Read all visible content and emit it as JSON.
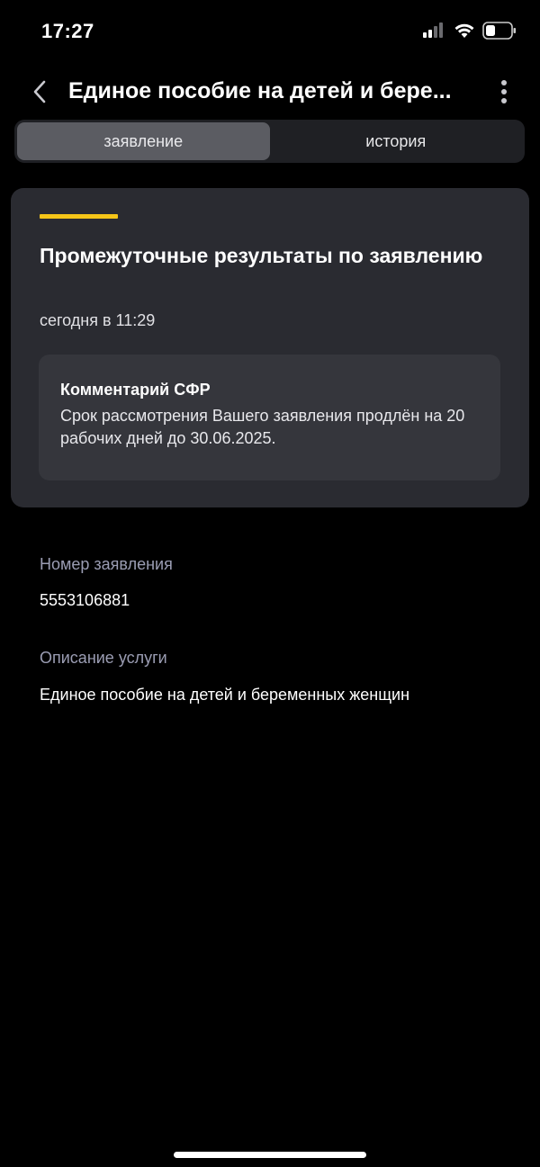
{
  "status_bar": {
    "time": "17:27",
    "icons": [
      "cellular-signal-icon",
      "wifi-icon",
      "battery-icon"
    ]
  },
  "header": {
    "title": "Единое пособие на детей и бере...",
    "back_icon": "chevron-left-icon",
    "more_icon": "more-vertical-icon"
  },
  "tabs": [
    {
      "label": "заявление",
      "active": true
    },
    {
      "label": "история",
      "active": false
    }
  ],
  "status_card": {
    "accent_color": "#f5c518",
    "title": "Промежуточные результаты по заявлению",
    "date": "сегодня в 11:29",
    "comment": {
      "title": "Комментарий СФР",
      "text": "Срок рассмотрения Вашего заявления продлён на 20 рабочих дней до 30.06.2025."
    }
  },
  "fields": [
    {
      "label": "Номер заявления",
      "value": "5553106881"
    },
    {
      "label": "Описание услуги",
      "value": "Единое пособие на детей и беременных женщин"
    }
  ],
  "colors": {
    "background": "#000000",
    "card": "#2a2b31",
    "accent": "#f5c518",
    "label": "#9b9db3"
  }
}
